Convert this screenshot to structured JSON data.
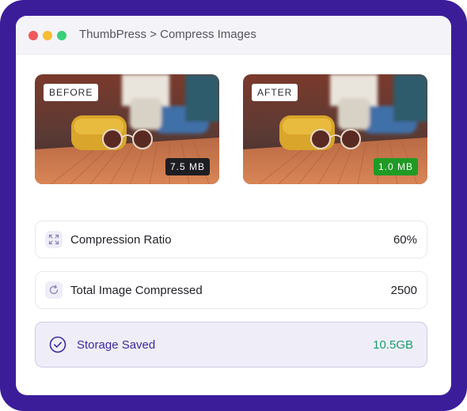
{
  "window": {
    "title": "ThumbPress > Compress Images"
  },
  "preview": {
    "before": {
      "tag": "BEFORE",
      "size": "7.5 MB"
    },
    "after": {
      "tag": "AFTER",
      "size": "1.0 MB"
    }
  },
  "stats": [
    {
      "icon": "expand-arrows-icon",
      "label": "Compression Ratio",
      "value": "60%"
    },
    {
      "icon": "refresh-icon",
      "label": "Total Image Compressed",
      "value": "2500"
    }
  ],
  "storage": {
    "icon": "check-circle-icon",
    "label": "Storage Saved",
    "value": "10.5GB"
  },
  "colors": {
    "frame": "#3b1d9a",
    "accent": "#3c2a9c",
    "saved_value": "#1a9c6a",
    "after_badge": "#1f9a25",
    "before_badge": "#1e1e22"
  }
}
